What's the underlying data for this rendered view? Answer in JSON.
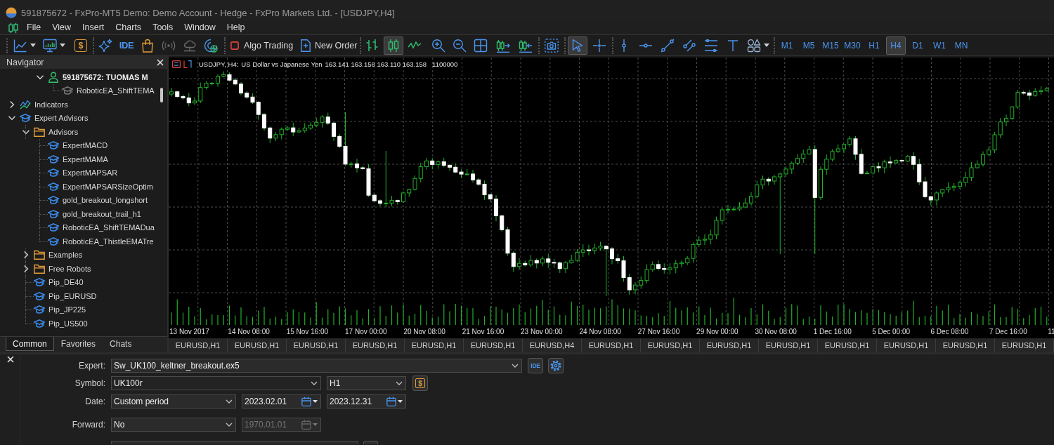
{
  "window": {
    "title": "591875672 - FxPro-MT5 Demo: Demo Account - Hedge - FxPro Markets Ltd. - [USDJPY,H4]"
  },
  "menu": [
    "File",
    "View",
    "Insert",
    "Charts",
    "Tools",
    "Window",
    "Help"
  ],
  "toolbar": {
    "currency": "$",
    "ide": "IDE",
    "algo_trading": {
      "label": "Algo Trading",
      "on": false
    },
    "new_order": "New Order",
    "chart_types": [
      {
        "kind": "bars",
        "selected": false
      },
      {
        "kind": "candles",
        "selected": true
      },
      {
        "kind": "line",
        "selected": false
      }
    ],
    "pointer_tools": [
      {
        "kind": "cursor",
        "selected": true
      },
      {
        "kind": "crosshair",
        "selected": false
      }
    ],
    "timeframes": [
      {
        "label": "M1",
        "selected": false
      },
      {
        "label": "M5",
        "selected": false
      },
      {
        "label": "M15",
        "selected": false
      },
      {
        "label": "M30",
        "selected": false
      },
      {
        "label": "H1",
        "selected": false
      },
      {
        "label": "H4",
        "selected": true
      },
      {
        "label": "D1",
        "selected": false
      },
      {
        "label": "W1",
        "selected": false
      },
      {
        "label": "MN",
        "selected": false
      }
    ]
  },
  "navigator": {
    "title": "Navigator",
    "account": {
      "label": "591875672: TUOMAS M",
      "kind": "account",
      "expanded": true,
      "children": [
        {
          "label": "RoboticEA_ShiftTEMA",
          "kind": "attached-expert"
        }
      ]
    },
    "tree": [
      {
        "label": "Indicators",
        "kind": "indicators",
        "expanded": false
      },
      {
        "label": "Expert Advisors",
        "kind": "expert",
        "expanded": true,
        "children": [
          {
            "label": "Advisors",
            "kind": "folder",
            "expanded": true,
            "children": [
              {
                "label": "ExpertMACD",
                "kind": "expert"
              },
              {
                "label": "ExpertMAMA",
                "kind": "expert"
              },
              {
                "label": "ExpertMAPSAR",
                "kind": "expert"
              },
              {
                "label": "ExpertMAPSARSizeOptim",
                "kind": "expert"
              },
              {
                "label": "gold_breakout_longshort",
                "kind": "expert"
              },
              {
                "label": "gold_breakout_trail_h1",
                "kind": "expert"
              },
              {
                "label": "RoboticEA_ShiftTEMADua",
                "kind": "expert"
              },
              {
                "label": "RoboticEA_ThistleEMATre",
                "kind": "expert"
              }
            ]
          },
          {
            "label": "Examples",
            "kind": "folder",
            "expanded": false
          },
          {
            "label": "Free Robots",
            "kind": "folder",
            "expanded": false
          },
          {
            "label": "Pip_DE40",
            "kind": "expert"
          },
          {
            "label": "Pip_EURUSD",
            "kind": "expert"
          },
          {
            "label": "Pip_JP225",
            "kind": "expert"
          },
          {
            "label": "Pip_US500",
            "kind": "expert"
          }
        ]
      }
    ],
    "tabs": [
      {
        "label": "Common",
        "selected": true
      },
      {
        "label": "Favorites",
        "selected": false
      },
      {
        "label": "Chats",
        "selected": false
      }
    ]
  },
  "chart": {
    "symbol": "USDJPY, H4:",
    "description": "US Dollar vs Japanese Yen",
    "prices": "163.141 163.158 163.110 163.158",
    "volume": "1100000",
    "time_axis": [
      "13 Nov 2017",
      "14 Nov 08:00",
      "15 Nov 16:00",
      "17 Nov 00:00",
      "20 Nov 08:00",
      "21 Nov 16:00",
      "23 Nov 00:00",
      "24 Nov 08:00",
      "27 Nov 16:00",
      "29 Nov 00:00",
      "30 Nov 08:00",
      "1 Dec 16:00",
      "5 Dec 00:00",
      "6 Dec 08:00",
      "7 Dec 16:00",
      "11"
    ],
    "tabs": [
      {
        "label": "EURUSD,H1",
        "selected": false
      },
      {
        "label": "EURUSD,H1",
        "selected": false
      },
      {
        "label": "EURUSD,H1",
        "selected": false
      },
      {
        "label": "EURUSD,H1",
        "selected": false
      },
      {
        "label": "EURUSD,H1",
        "selected": false
      },
      {
        "label": "EURUSD,H1",
        "selected": false
      },
      {
        "label": "EURUSD,H4",
        "selected": false
      },
      {
        "label": "EURUSD,H1",
        "selected": false
      },
      {
        "label": "EURUSD,H1",
        "selected": false
      },
      {
        "label": "EURUSD,H1",
        "selected": false
      },
      {
        "label": "EURUSD,H1",
        "selected": false
      },
      {
        "label": "EURUSD,H1",
        "selected": false
      },
      {
        "label": "EURUSD,H1",
        "selected": false
      },
      {
        "label": "EURUSD,H1",
        "selected": false
      },
      {
        "label": "EURUSD,H1",
        "selected": false
      }
    ]
  },
  "tester": {
    "expert": {
      "label": "Expert:",
      "value": "Sw_UK100_keltner_breakout.ex5",
      "ide": "IDE"
    },
    "symbol": {
      "label": "Symbol:",
      "value": "UK100r",
      "period": "H1",
      "currency": "$"
    },
    "date": {
      "label": "Date:",
      "value": "Custom period",
      "from": {
        "value": "2023.02.01",
        "disabled": false
      },
      "to": {
        "value": "2023.12.31",
        "disabled": false
      }
    },
    "forward": {
      "label": "Forward:",
      "value": "No",
      "date": {
        "value": "1970.01.01",
        "disabled": true
      }
    }
  }
}
